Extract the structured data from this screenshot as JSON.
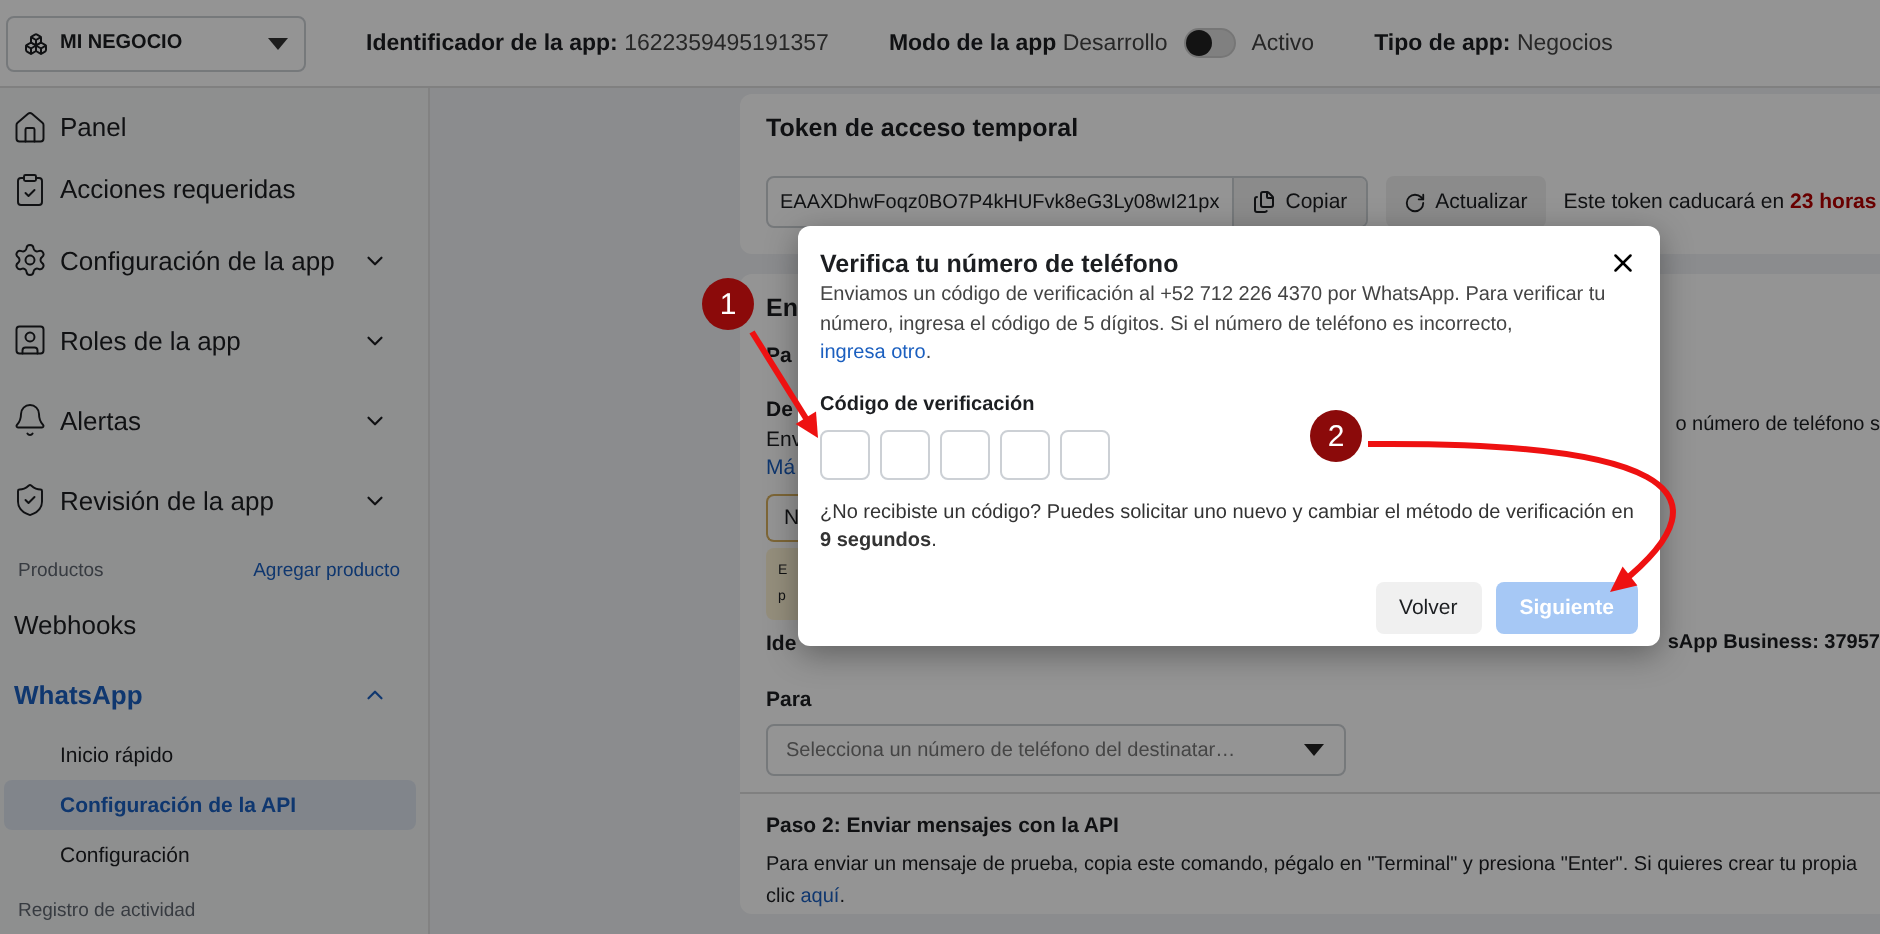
{
  "top_bar": {
    "business": "MI NEGOCIO",
    "app_id_label": "Identificador de la app:",
    "app_id": "1622359495191357",
    "mode_label": "Modo de la app",
    "mode_off": "Desarrollo",
    "mode_on": "Activo",
    "active": false,
    "type_label": "Tipo de app:",
    "type": "Negocios"
  },
  "sidebar": {
    "items": [
      {
        "label": "Panel",
        "expandable": false
      },
      {
        "label": "Acciones requeridas",
        "expandable": false
      },
      {
        "label": "Configuración de la app",
        "expandable": true
      },
      {
        "label": "Roles de la app",
        "expandable": true
      },
      {
        "label": "Alertas",
        "expandable": true
      },
      {
        "label": "Revisión de la app",
        "expandable": true
      }
    ],
    "products_label": "Productos",
    "add_product": "Agregar producto",
    "products": [
      {
        "label": "Webhooks"
      },
      {
        "label": "WhatsApp",
        "expanded": true,
        "children": [
          {
            "label": "Inicio rápido",
            "selected": false
          },
          {
            "label": "Configuración de la API",
            "selected": true
          },
          {
            "label": "Configuración",
            "selected": false
          }
        ]
      }
    ],
    "activity": "Registro de actividad"
  },
  "token_card": {
    "title": "Token de acceso temporal",
    "token": "EAAXDhwFoqz0BO7P4kHUFvk8eG3Ly08wI21px",
    "copy": "Copiar",
    "refresh": "Actualizar",
    "expiry": "Este token caducará en **23 horas**"
  },
  "send_card": {
    "left_fragments": [
      "En",
      "Pa",
      "De",
      "Env",
      "Má"
    ],
    "right_fragment": "o número de teléfono s",
    "field_fragment": "N",
    "notice_fragments": [
      "E",
      "p"
    ],
    "id_fragment": "Ide",
    "id_right_fragment": "sApp Business: 37957",
    "to_label": "Para",
    "to_placeholder": "Selecciona un número de teléfono del destinatar…",
    "step2_title": "Paso 2: Enviar mensajes con la API",
    "step2_text": "Para enviar un mensaje de prueba, copia este comando, pégalo en \"Terminal\" y presiona \"Enter\". Si quieres crear tu propia",
    "step2_text2": "clic ",
    "step2_link": "aquí",
    "step2_end": "."
  },
  "modal": {
    "title": "Verifica tu número de teléfono",
    "body": "Enviamos un código de verificación al +52 712 226 4370 por WhatsApp. Para verificar tu número, ingresa el código de 5 dígitos. Si el número de teléfono es incorrecto, ",
    "body_link": "ingresa otro",
    "body_end": ".",
    "code_label": "Código de verificación",
    "code_boxes": [
      {
        "filled": false
      },
      {
        "filled": false
      },
      {
        "filled": false
      },
      {
        "filled": false
      },
      {
        "filled": false
      }
    ],
    "resend": "¿No recibiste un código? Puedes solicitar uno nuevo y cambiar el método de verificación en **9 segundos**.",
    "back": "Volver",
    "next": "Siguiente",
    "next_disabled": true
  },
  "annotations": [
    {
      "number": "1"
    },
    {
      "number": "2"
    }
  ]
}
